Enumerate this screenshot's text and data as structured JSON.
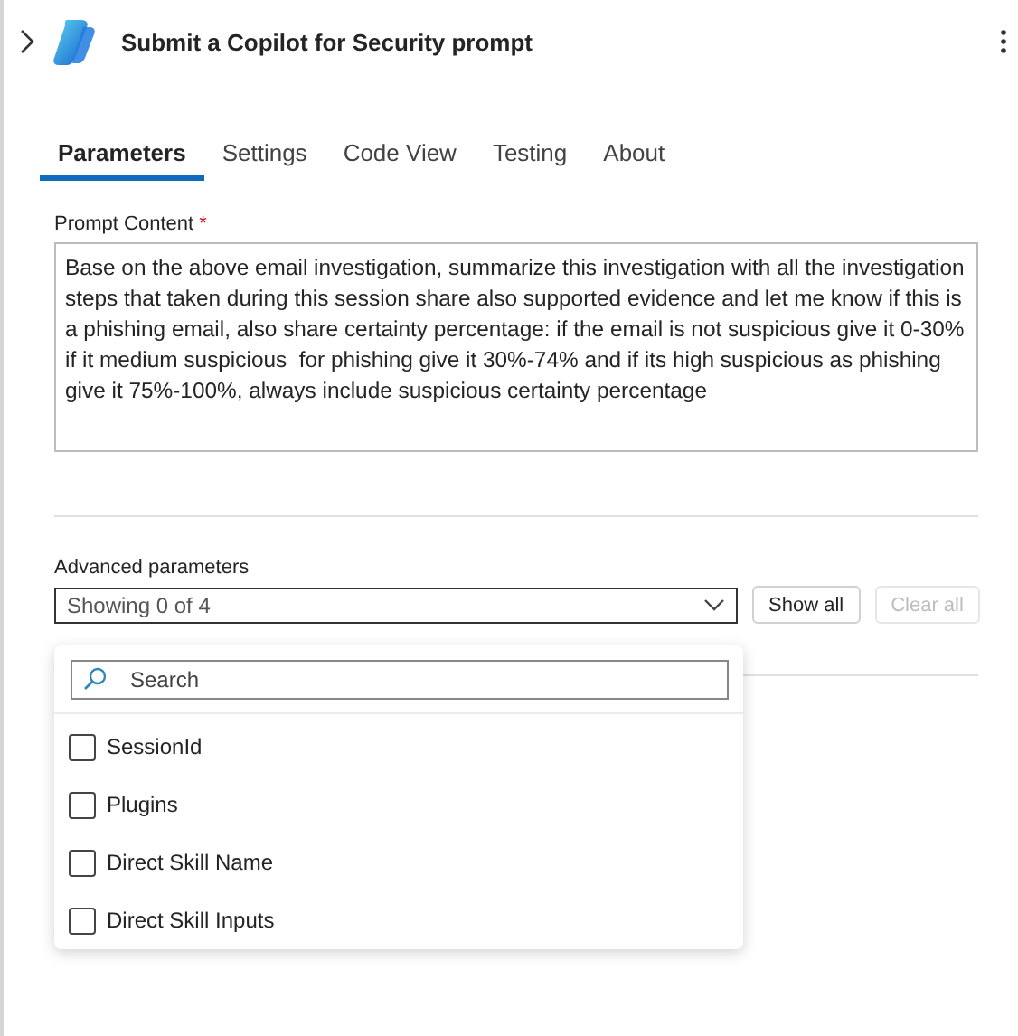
{
  "header": {
    "title": "Submit a Copilot for Security prompt"
  },
  "tabs": [
    {
      "label": "Parameters",
      "selected": true
    },
    {
      "label": "Settings",
      "selected": false
    },
    {
      "label": "Code View",
      "selected": false
    },
    {
      "label": "Testing",
      "selected": false
    },
    {
      "label": "About",
      "selected": false
    }
  ],
  "prompt": {
    "label": "Prompt Content",
    "required_mark": "*",
    "value": "Base on the above email investigation, summarize this investigation with all the investigation steps that taken during this session share also supported evidence and let me know if this is a phishing email, also share certainty percentage: if the email is not suspicious give it 0-30% if it medium suspicious  for phishing give it 30%-74% and if its high suspicious as phishing give it 75%-100%, always include suspicious certainty percentage"
  },
  "advanced": {
    "label": "Advanced parameters",
    "dropdown_value": "Showing 0 of 4",
    "expanded": true,
    "buttons": [
      {
        "label": "Show all",
        "disabled": false
      },
      {
        "label": "Clear all",
        "disabled": true
      }
    ],
    "search_placeholder": "Search",
    "options": [
      {
        "label": "SessionId",
        "checked": false
      },
      {
        "label": "Plugins",
        "checked": false
      },
      {
        "label": "Direct Skill Name",
        "checked": false
      },
      {
        "label": "Direct Skill Inputs",
        "checked": false
      }
    ]
  }
}
